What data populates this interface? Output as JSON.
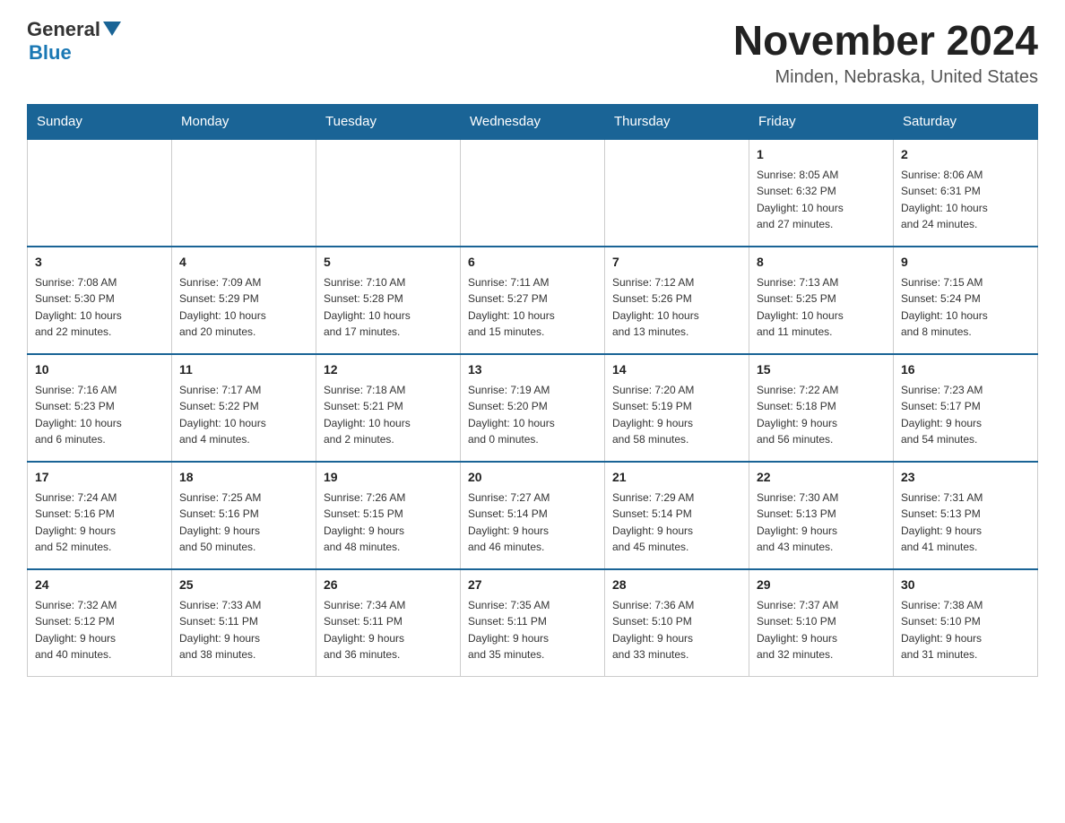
{
  "header": {
    "logo_general": "General",
    "logo_blue": "Blue",
    "main_title": "November 2024",
    "subtitle": "Minden, Nebraska, United States"
  },
  "days_of_week": [
    "Sunday",
    "Monday",
    "Tuesday",
    "Wednesday",
    "Thursday",
    "Friday",
    "Saturday"
  ],
  "weeks": [
    {
      "days": [
        {
          "number": "",
          "info": ""
        },
        {
          "number": "",
          "info": ""
        },
        {
          "number": "",
          "info": ""
        },
        {
          "number": "",
          "info": ""
        },
        {
          "number": "",
          "info": ""
        },
        {
          "number": "1",
          "info": "Sunrise: 8:05 AM\nSunset: 6:32 PM\nDaylight: 10 hours\nand 27 minutes."
        },
        {
          "number": "2",
          "info": "Sunrise: 8:06 AM\nSunset: 6:31 PM\nDaylight: 10 hours\nand 24 minutes."
        }
      ]
    },
    {
      "days": [
        {
          "number": "3",
          "info": "Sunrise: 7:08 AM\nSunset: 5:30 PM\nDaylight: 10 hours\nand 22 minutes."
        },
        {
          "number": "4",
          "info": "Sunrise: 7:09 AM\nSunset: 5:29 PM\nDaylight: 10 hours\nand 20 minutes."
        },
        {
          "number": "5",
          "info": "Sunrise: 7:10 AM\nSunset: 5:28 PM\nDaylight: 10 hours\nand 17 minutes."
        },
        {
          "number": "6",
          "info": "Sunrise: 7:11 AM\nSunset: 5:27 PM\nDaylight: 10 hours\nand 15 minutes."
        },
        {
          "number": "7",
          "info": "Sunrise: 7:12 AM\nSunset: 5:26 PM\nDaylight: 10 hours\nand 13 minutes."
        },
        {
          "number": "8",
          "info": "Sunrise: 7:13 AM\nSunset: 5:25 PM\nDaylight: 10 hours\nand 11 minutes."
        },
        {
          "number": "9",
          "info": "Sunrise: 7:15 AM\nSunset: 5:24 PM\nDaylight: 10 hours\nand 8 minutes."
        }
      ]
    },
    {
      "days": [
        {
          "number": "10",
          "info": "Sunrise: 7:16 AM\nSunset: 5:23 PM\nDaylight: 10 hours\nand 6 minutes."
        },
        {
          "number": "11",
          "info": "Sunrise: 7:17 AM\nSunset: 5:22 PM\nDaylight: 10 hours\nand 4 minutes."
        },
        {
          "number": "12",
          "info": "Sunrise: 7:18 AM\nSunset: 5:21 PM\nDaylight: 10 hours\nand 2 minutes."
        },
        {
          "number": "13",
          "info": "Sunrise: 7:19 AM\nSunset: 5:20 PM\nDaylight: 10 hours\nand 0 minutes."
        },
        {
          "number": "14",
          "info": "Sunrise: 7:20 AM\nSunset: 5:19 PM\nDaylight: 9 hours\nand 58 minutes."
        },
        {
          "number": "15",
          "info": "Sunrise: 7:22 AM\nSunset: 5:18 PM\nDaylight: 9 hours\nand 56 minutes."
        },
        {
          "number": "16",
          "info": "Sunrise: 7:23 AM\nSunset: 5:17 PM\nDaylight: 9 hours\nand 54 minutes."
        }
      ]
    },
    {
      "days": [
        {
          "number": "17",
          "info": "Sunrise: 7:24 AM\nSunset: 5:16 PM\nDaylight: 9 hours\nand 52 minutes."
        },
        {
          "number": "18",
          "info": "Sunrise: 7:25 AM\nSunset: 5:16 PM\nDaylight: 9 hours\nand 50 minutes."
        },
        {
          "number": "19",
          "info": "Sunrise: 7:26 AM\nSunset: 5:15 PM\nDaylight: 9 hours\nand 48 minutes."
        },
        {
          "number": "20",
          "info": "Sunrise: 7:27 AM\nSunset: 5:14 PM\nDaylight: 9 hours\nand 46 minutes."
        },
        {
          "number": "21",
          "info": "Sunrise: 7:29 AM\nSunset: 5:14 PM\nDaylight: 9 hours\nand 45 minutes."
        },
        {
          "number": "22",
          "info": "Sunrise: 7:30 AM\nSunset: 5:13 PM\nDaylight: 9 hours\nand 43 minutes."
        },
        {
          "number": "23",
          "info": "Sunrise: 7:31 AM\nSunset: 5:13 PM\nDaylight: 9 hours\nand 41 minutes."
        }
      ]
    },
    {
      "days": [
        {
          "number": "24",
          "info": "Sunrise: 7:32 AM\nSunset: 5:12 PM\nDaylight: 9 hours\nand 40 minutes."
        },
        {
          "number": "25",
          "info": "Sunrise: 7:33 AM\nSunset: 5:11 PM\nDaylight: 9 hours\nand 38 minutes."
        },
        {
          "number": "26",
          "info": "Sunrise: 7:34 AM\nSunset: 5:11 PM\nDaylight: 9 hours\nand 36 minutes."
        },
        {
          "number": "27",
          "info": "Sunrise: 7:35 AM\nSunset: 5:11 PM\nDaylight: 9 hours\nand 35 minutes."
        },
        {
          "number": "28",
          "info": "Sunrise: 7:36 AM\nSunset: 5:10 PM\nDaylight: 9 hours\nand 33 minutes."
        },
        {
          "number": "29",
          "info": "Sunrise: 7:37 AM\nSunset: 5:10 PM\nDaylight: 9 hours\nand 32 minutes."
        },
        {
          "number": "30",
          "info": "Sunrise: 7:38 AM\nSunset: 5:10 PM\nDaylight: 9 hours\nand 31 minutes."
        }
      ]
    }
  ]
}
